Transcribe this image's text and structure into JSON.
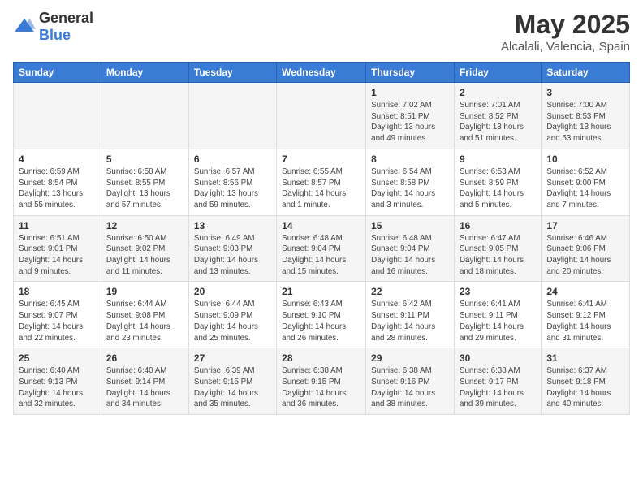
{
  "header": {
    "logo_general": "General",
    "logo_blue": "Blue",
    "month_title": "May 2025",
    "location": "Alcalali, Valencia, Spain"
  },
  "days_of_week": [
    "Sunday",
    "Monday",
    "Tuesday",
    "Wednesday",
    "Thursday",
    "Friday",
    "Saturday"
  ],
  "weeks": [
    [
      {
        "day": "",
        "info": ""
      },
      {
        "day": "",
        "info": ""
      },
      {
        "day": "",
        "info": ""
      },
      {
        "day": "",
        "info": ""
      },
      {
        "day": "1",
        "info": "Sunrise: 7:02 AM\nSunset: 8:51 PM\nDaylight: 13 hours and 49 minutes."
      },
      {
        "day": "2",
        "info": "Sunrise: 7:01 AM\nSunset: 8:52 PM\nDaylight: 13 hours and 51 minutes."
      },
      {
        "day": "3",
        "info": "Sunrise: 7:00 AM\nSunset: 8:53 PM\nDaylight: 13 hours and 53 minutes."
      }
    ],
    [
      {
        "day": "4",
        "info": "Sunrise: 6:59 AM\nSunset: 8:54 PM\nDaylight: 13 hours and 55 minutes."
      },
      {
        "day": "5",
        "info": "Sunrise: 6:58 AM\nSunset: 8:55 PM\nDaylight: 13 hours and 57 minutes."
      },
      {
        "day": "6",
        "info": "Sunrise: 6:57 AM\nSunset: 8:56 PM\nDaylight: 13 hours and 59 minutes."
      },
      {
        "day": "7",
        "info": "Sunrise: 6:55 AM\nSunset: 8:57 PM\nDaylight: 14 hours and 1 minute."
      },
      {
        "day": "8",
        "info": "Sunrise: 6:54 AM\nSunset: 8:58 PM\nDaylight: 14 hours and 3 minutes."
      },
      {
        "day": "9",
        "info": "Sunrise: 6:53 AM\nSunset: 8:59 PM\nDaylight: 14 hours and 5 minutes."
      },
      {
        "day": "10",
        "info": "Sunrise: 6:52 AM\nSunset: 9:00 PM\nDaylight: 14 hours and 7 minutes."
      }
    ],
    [
      {
        "day": "11",
        "info": "Sunrise: 6:51 AM\nSunset: 9:01 PM\nDaylight: 14 hours and 9 minutes."
      },
      {
        "day": "12",
        "info": "Sunrise: 6:50 AM\nSunset: 9:02 PM\nDaylight: 14 hours and 11 minutes."
      },
      {
        "day": "13",
        "info": "Sunrise: 6:49 AM\nSunset: 9:03 PM\nDaylight: 14 hours and 13 minutes."
      },
      {
        "day": "14",
        "info": "Sunrise: 6:48 AM\nSunset: 9:04 PM\nDaylight: 14 hours and 15 minutes."
      },
      {
        "day": "15",
        "info": "Sunrise: 6:48 AM\nSunset: 9:04 PM\nDaylight: 14 hours and 16 minutes."
      },
      {
        "day": "16",
        "info": "Sunrise: 6:47 AM\nSunset: 9:05 PM\nDaylight: 14 hours and 18 minutes."
      },
      {
        "day": "17",
        "info": "Sunrise: 6:46 AM\nSunset: 9:06 PM\nDaylight: 14 hours and 20 minutes."
      }
    ],
    [
      {
        "day": "18",
        "info": "Sunrise: 6:45 AM\nSunset: 9:07 PM\nDaylight: 14 hours and 22 minutes."
      },
      {
        "day": "19",
        "info": "Sunrise: 6:44 AM\nSunset: 9:08 PM\nDaylight: 14 hours and 23 minutes."
      },
      {
        "day": "20",
        "info": "Sunrise: 6:44 AM\nSunset: 9:09 PM\nDaylight: 14 hours and 25 minutes."
      },
      {
        "day": "21",
        "info": "Sunrise: 6:43 AM\nSunset: 9:10 PM\nDaylight: 14 hours and 26 minutes."
      },
      {
        "day": "22",
        "info": "Sunrise: 6:42 AM\nSunset: 9:11 PM\nDaylight: 14 hours and 28 minutes."
      },
      {
        "day": "23",
        "info": "Sunrise: 6:41 AM\nSunset: 9:11 PM\nDaylight: 14 hours and 29 minutes."
      },
      {
        "day": "24",
        "info": "Sunrise: 6:41 AM\nSunset: 9:12 PM\nDaylight: 14 hours and 31 minutes."
      }
    ],
    [
      {
        "day": "25",
        "info": "Sunrise: 6:40 AM\nSunset: 9:13 PM\nDaylight: 14 hours and 32 minutes."
      },
      {
        "day": "26",
        "info": "Sunrise: 6:40 AM\nSunset: 9:14 PM\nDaylight: 14 hours and 34 minutes."
      },
      {
        "day": "27",
        "info": "Sunrise: 6:39 AM\nSunset: 9:15 PM\nDaylight: 14 hours and 35 minutes."
      },
      {
        "day": "28",
        "info": "Sunrise: 6:38 AM\nSunset: 9:15 PM\nDaylight: 14 hours and 36 minutes."
      },
      {
        "day": "29",
        "info": "Sunrise: 6:38 AM\nSunset: 9:16 PM\nDaylight: 14 hours and 38 minutes."
      },
      {
        "day": "30",
        "info": "Sunrise: 6:38 AM\nSunset: 9:17 PM\nDaylight: 14 hours and 39 minutes."
      },
      {
        "day": "31",
        "info": "Sunrise: 6:37 AM\nSunset: 9:18 PM\nDaylight: 14 hours and 40 minutes."
      }
    ]
  ]
}
